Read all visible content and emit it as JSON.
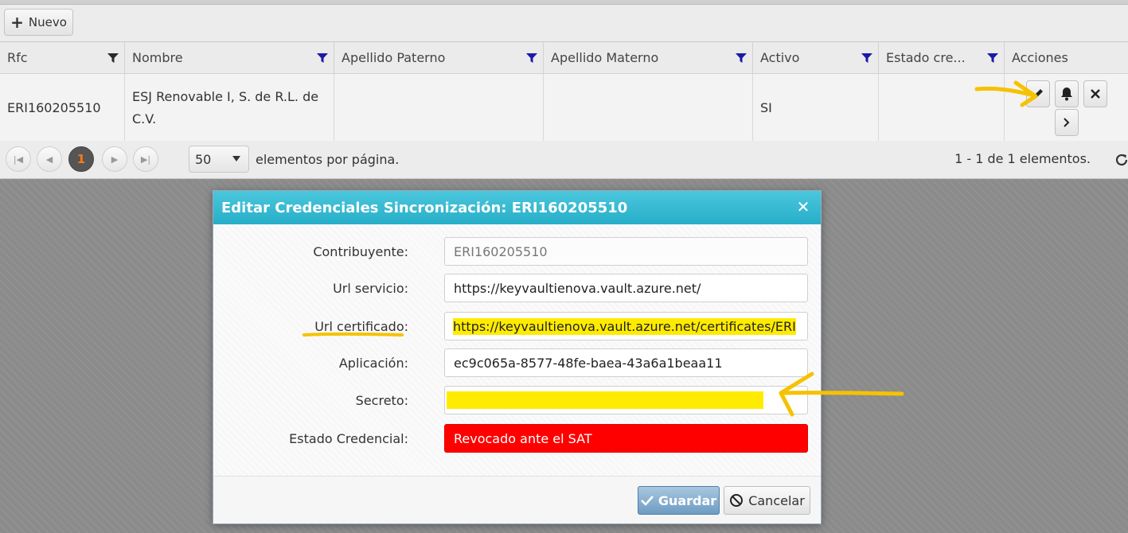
{
  "toolbar": {
    "new_label": "Nuevo"
  },
  "grid": {
    "columns": [
      "Rfc",
      "Nombre",
      "Apellido Paterno",
      "Apellido Materno",
      "Activo",
      "Estado cre...",
      "Acciones"
    ],
    "rows": [
      {
        "rfc": "ERI160205510",
        "nombre": "ESJ Renovable I, S. de R.L. de C.V.",
        "apellido_paterno": "",
        "apellido_materno": "",
        "activo": "SI",
        "estado": ""
      }
    ]
  },
  "pager": {
    "current_page": "1",
    "page_size": "50",
    "per_page_label": "elementos por página.",
    "summary": "1 - 1 de 1 elementos."
  },
  "modal": {
    "title": "Editar Credenciales Sincronización: ERI160205510",
    "fields": [
      {
        "label": "Contribuyente:",
        "value": "ERI160205510"
      },
      {
        "label": "Url servicio:",
        "value": "https://keyvaultienova.vault.azure.net/"
      },
      {
        "label": "Url certificado:",
        "value": "https://keyvaultienova.vault.azure.net/certificates/ERI"
      },
      {
        "label": "Aplicación:",
        "value": "ec9c065a-8577-48fe-baea-43a6a1beaa11"
      },
      {
        "label": "Secreto:",
        "value": ""
      },
      {
        "label": "Estado Credencial:",
        "value": "Revocado ante el SAT"
      }
    ],
    "save_label": "Guardar",
    "cancel_label": "Cancelar"
  },
  "colors": {
    "header_bar": "#27aec8",
    "highlight": "#ffeb00",
    "status_revoked": "#ff0000",
    "annotation": "#f5c200",
    "current_page": "#ff7a1a"
  }
}
